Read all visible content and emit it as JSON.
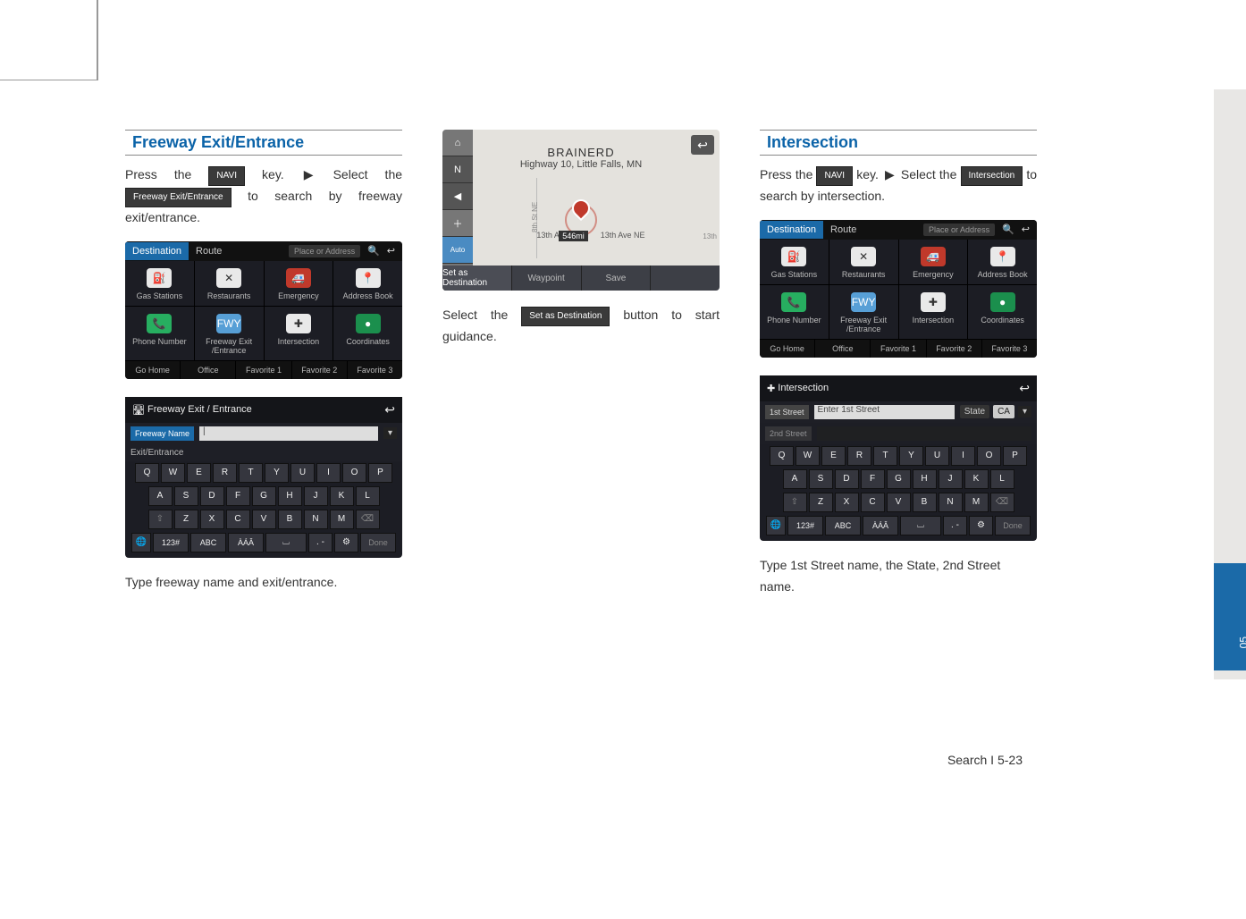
{
  "page": {
    "footer": "Search I 5-23",
    "side_num": "05"
  },
  "col1": {
    "heading": "Freeway Exit/Entrance",
    "text1a": "Press the ",
    "text1b": " key. ",
    "text1c": " Select the ",
    "text1d": " to search by freeway exit/entrance.",
    "key_navi": "NAVI",
    "key_fee": "Freeway Exit/Entrance",
    "caption": "Type freeway name and exit/entrance."
  },
  "col2": {
    "text_a": "Select the ",
    "text_b": " button to start guidance.",
    "key_set": "Set as Destination"
  },
  "col3": {
    "heading": "Intersection",
    "text1a": "Press the ",
    "text1b": " key. ",
    "text1c": " Select the ",
    "text1d": " to search by intersection.",
    "key_navi": "NAVI",
    "key_int": "Intersection",
    "caption": "Type 1st Street name, the State, 2nd Street name."
  },
  "nav": {
    "tab_dest": "Destination",
    "tab_route": "Route",
    "search_ph": "Place or Address",
    "row1": [
      {
        "icon": "⛽",
        "label": "Gas Stations",
        "cls": ""
      },
      {
        "icon": "✕",
        "label": "Restaurants",
        "cls": ""
      },
      {
        "icon": "🚑",
        "label": "Emergency",
        "cls": "red"
      },
      {
        "icon": "📍",
        "label": "Address Book",
        "cls": ""
      }
    ],
    "row2": [
      {
        "icon": "📞",
        "label": "Phone Number",
        "cls": "green"
      },
      {
        "icon": "FWY",
        "label": "Freeway Exit /Entrance",
        "cls": "blue"
      },
      {
        "icon": "✚",
        "label": "Intersection",
        "cls": ""
      },
      {
        "icon": "●",
        "label": "Coordinates",
        "cls": "dkgreen"
      }
    ],
    "favs": [
      "Go Home",
      "Office",
      "Favorite 1",
      "Favorite 2",
      "Favorite 3"
    ]
  },
  "kb1": {
    "title": "Freeway Exit / Entrance",
    "label1": "Freeway Name",
    "label2": "Exit/Entrance",
    "rowQ": [
      "Q",
      "W",
      "E",
      "R",
      "T",
      "Y",
      "U",
      "I",
      "O",
      "P"
    ],
    "rowA": [
      "A",
      "S",
      "D",
      "F",
      "G",
      "H",
      "J",
      "K",
      "L"
    ],
    "rowZ": [
      "⇧",
      "Z",
      "X",
      "C",
      "V",
      "B",
      "N",
      "M",
      "⌫"
    ],
    "rowB": [
      "",
      "123#",
      "ABC",
      "ÀÁÂ",
      "␣",
      ". -",
      "⚙",
      "Done"
    ]
  },
  "kb2": {
    "title": "Intersection",
    "label1_short": "1st Street",
    "label1_ph": "Enter 1st Street",
    "state_lbl": "State",
    "state_val": "CA",
    "label2_short": "2nd Street",
    "label2_ph": "",
    "rowQ": [
      "Q",
      "W",
      "E",
      "R",
      "T",
      "Y",
      "U",
      "I",
      "O",
      "P"
    ],
    "rowA": [
      "A",
      "S",
      "D",
      "F",
      "G",
      "H",
      "J",
      "K",
      "L"
    ],
    "rowZ": [
      "⇧",
      "Z",
      "X",
      "C",
      "V",
      "B",
      "N",
      "M",
      "⌫"
    ],
    "rowB": [
      "",
      "123#",
      "ABC",
      "ÀÁÂ",
      "␣",
      ". -",
      "⚙",
      "Done"
    ]
  },
  "map": {
    "title_main": "BRAINERD",
    "subtitle": "Highway 10, Little Falls, MN",
    "side": [
      "⌂",
      "N",
      "◀",
      "＋",
      "Auto",
      "－"
    ],
    "dist": "546mi",
    "street": "13th Ave NE",
    "left_label": "13th A",
    "edge": "13th",
    "vroad": "8th St NE",
    "bottom": [
      "Set as Destination",
      "Waypoint",
      "Save",
      ""
    ]
  }
}
